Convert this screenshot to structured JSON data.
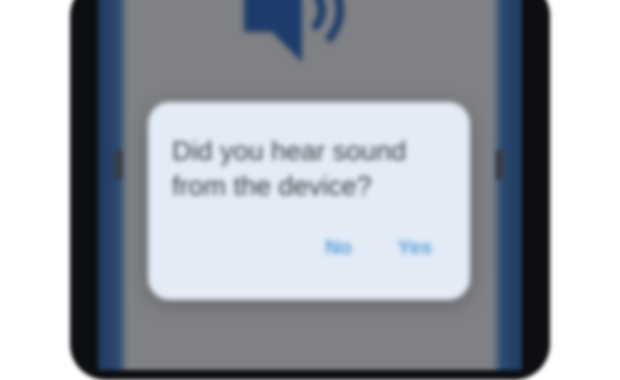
{
  "dialog": {
    "message": "Did you hear sound from the device?",
    "actions": [
      {
        "label": "No"
      },
      {
        "label": "Yes"
      }
    ]
  },
  "icons": {
    "speaker": "speaker-volume-icon"
  },
  "colors": {
    "dialog_bg": "#e3ebf6",
    "screen_bg": "#7f8184",
    "accent": "#5aa0d8",
    "icon": "#1c3d6b"
  }
}
